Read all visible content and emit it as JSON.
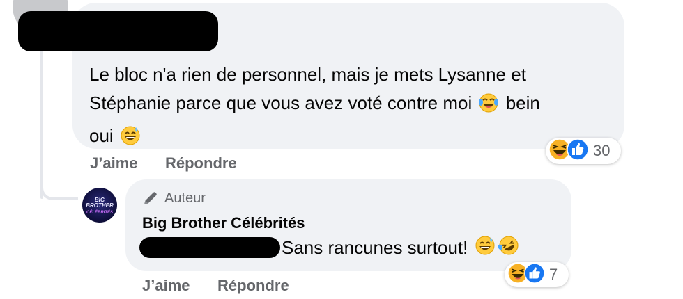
{
  "comment": {
    "text_line1": "Le bloc n'a rien de personnel, mais je mets Lysanne et",
    "text_line2a": "Stéphanie parce que vous avez voté contre moi",
    "text_line2b": "bein",
    "text_line3": "oui",
    "reaction_count": "30",
    "like_label": "J’aime",
    "reply_label": "Répondre",
    "reaction_icons": [
      "haha-icon",
      "like-icon"
    ]
  },
  "reply": {
    "author_badge": "Auteur",
    "page_name": "Big Brother Célébrités",
    "text": "Sans rancunes surtout!",
    "reaction_count": "7",
    "like_label": "J’aime",
    "reply_label": "Répondre",
    "avatar_text": "BIG BROTHER",
    "avatar_sub": "CÉLÉBRITÉS"
  },
  "colors": {
    "bubble": "#f0f2f5",
    "secondary_text": "#65676b",
    "like_blue": "#1877f2",
    "haha_yellow": "#f7b125"
  }
}
